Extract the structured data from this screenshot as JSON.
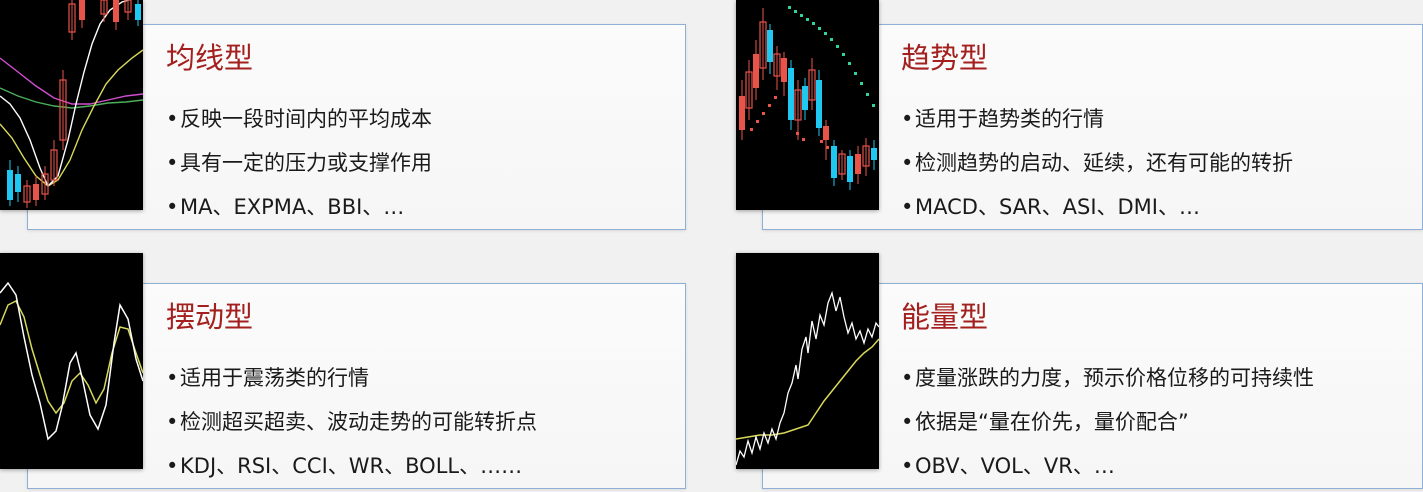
{
  "cards": [
    {
      "id": "moving-average",
      "title": "均线型",
      "bullets": [
        "反映一段时间内的平均成本",
        "具有一定的压力或支撑作用",
        "MA、EXPMA、BBI、…"
      ]
    },
    {
      "id": "trend",
      "title": "趋势型",
      "bullets": [
        "适用于趋势类的行情",
        "检测趋势的启动、延续，还有可能的转折",
        "MACD、SAR、ASI、DMI、…"
      ]
    },
    {
      "id": "oscillator",
      "title": "摆动型",
      "bullets": [
        "适用于震荡类的行情",
        "检测超买超卖、波动走势的可能转折点",
        "KDJ、RSI、CCI、WR、BOLL、……"
      ]
    },
    {
      "id": "volume",
      "title": "能量型",
      "bullets": [
        "度量涨跌的力度，预示价格位移的可持续性",
        "依据是“量在价先，量价配合”",
        "OBV、VOL、VR、…"
      ]
    }
  ],
  "bullet_symbol": "•",
  "colors": {
    "title": "#a3201f",
    "card_border": "#8fb0d4",
    "candle_up": "#e8534a",
    "candle_down": "#1ec8f0",
    "line_white": "#ffffff",
    "line_yellow": "#d8d85a",
    "line_magenta": "#d04fd0",
    "line_green": "#4caf5a",
    "sar_dots": "#2fd39c"
  }
}
